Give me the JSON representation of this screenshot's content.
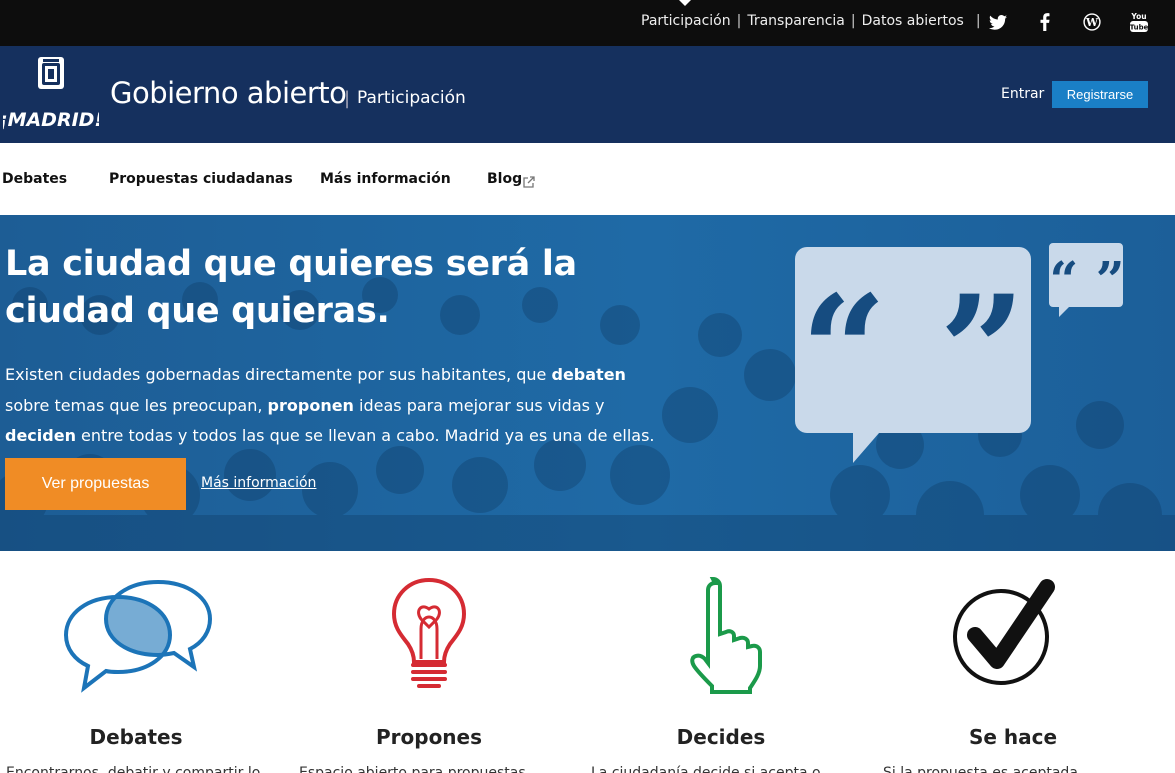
{
  "topbar": {
    "links": [
      "Participación",
      "Transparencia",
      "Datos abiertos"
    ],
    "social_icons": [
      "twitter-icon",
      "facebook-icon",
      "wordpress-icon",
      "youtube-icon"
    ]
  },
  "header": {
    "logo_text": "¡MADRID!",
    "title": "Gobierno abierto",
    "separator": "|",
    "subtitle": "Participación",
    "login_label": "Entrar",
    "register_label": "Registrarse"
  },
  "nav": {
    "items": [
      "Debates",
      "Propuestas ciudadanas",
      "Más información",
      "Blog"
    ]
  },
  "hero": {
    "title": "La ciudad que quieres será la ciudad que quieras.",
    "text_1": "Existen ciudades gobernadas directamente por sus habitantes, que ",
    "bold_1": "debaten",
    "text_2": " sobre temas que les preocupan, ",
    "bold_2": "proponen",
    "text_3": " ideas para mejorar sus vidas y ",
    "bold_3": "deciden",
    "text_4": " entre todas y todos las que se llevan a cabo. Madrid ya es una de ellas.",
    "cta_label": "Ver propuestas",
    "more_label": "Más información"
  },
  "features": [
    {
      "title": "Debates",
      "text": "Encontrarnos, debatir y compartir lo"
    },
    {
      "title": "Propones",
      "text": "Espacio abierto para propuestas"
    },
    {
      "title": "Decides",
      "text": "La ciudadanía decide si acepta o"
    },
    {
      "title": "Se hace",
      "text": "Si la propuesta es aceptada"
    }
  ],
  "colors": {
    "topbar": "#0d0d0d",
    "header": "#15305e",
    "accent_button": "#1a7fc6",
    "cta": "#f08c25",
    "debates": "#1c74b8",
    "propones": "#d52b33",
    "decides": "#1b9a4a",
    "sehace": "#111111"
  }
}
